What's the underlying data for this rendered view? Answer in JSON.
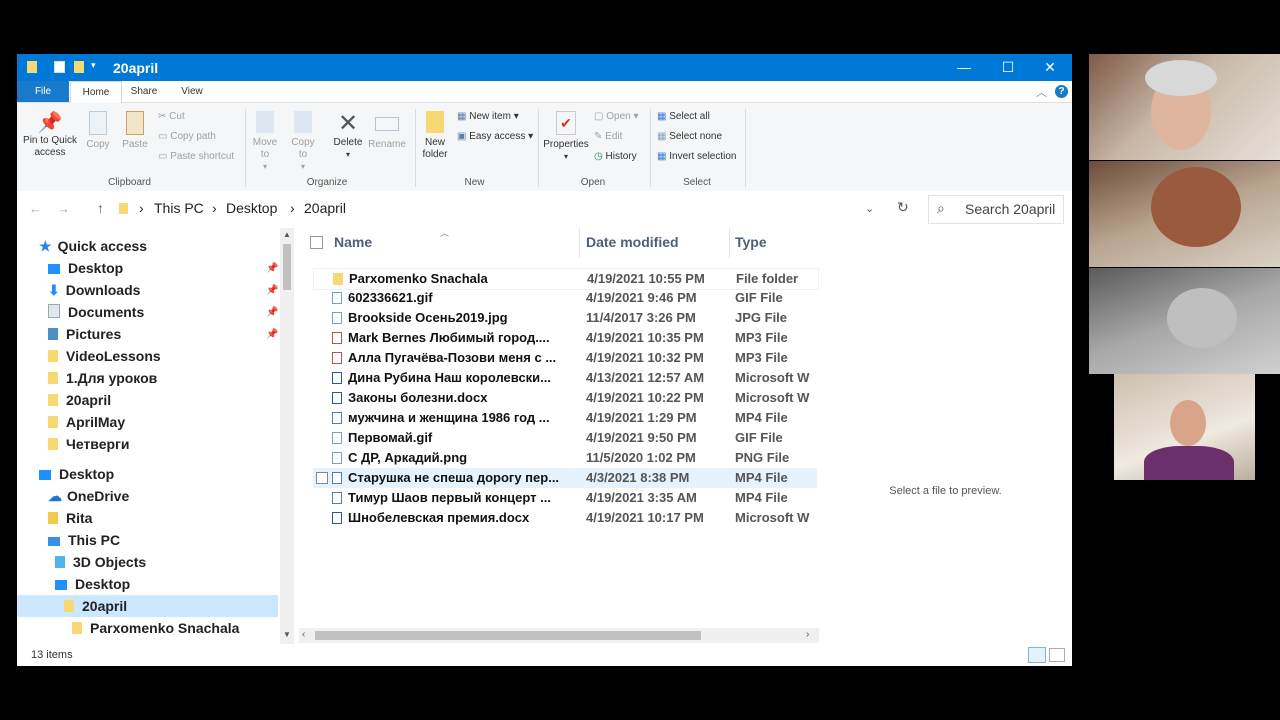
{
  "window": {
    "title": "20april",
    "min": "—",
    "max": "☐",
    "close": "✕"
  },
  "tabs": {
    "file": "File",
    "home": "Home",
    "share": "Share",
    "view": "View"
  },
  "ribbon": {
    "pin": "Pin to Quick access",
    "copy": "Copy",
    "paste": "Paste",
    "cut": "Cut",
    "copy_path": "Copy path",
    "paste_shortcut": "Paste shortcut",
    "move_to": "Move to",
    "copy_to": "Copy to",
    "delete": "Delete",
    "rename": "Rename",
    "new_folder": "New folder",
    "new_item": "New item",
    "easy_access": "Easy access",
    "properties": "Properties",
    "open": "Open",
    "edit": "Edit",
    "history": "History",
    "select_all": "Select all",
    "select_none": "Select none",
    "invert_selection": "Invert selection",
    "groups": {
      "clipboard": "Clipboard",
      "organize": "Organize",
      "new": "New",
      "open": "Open",
      "select": "Select"
    }
  },
  "address": {
    "crumbs": [
      "This PC",
      "Desktop",
      "20april"
    ],
    "search_placeholder": "Search 20april"
  },
  "sidebar": {
    "items": [
      {
        "label": "Quick access"
      },
      {
        "label": "Desktop"
      },
      {
        "label": "Downloads"
      },
      {
        "label": "Documents"
      },
      {
        "label": "Pictures"
      },
      {
        "label": "VideoLessons"
      },
      {
        "label": "1.Для уроков"
      },
      {
        "label": "20april"
      },
      {
        "label": "AprilMay"
      },
      {
        "label": "Четверги"
      },
      {
        "label": "Desktop"
      },
      {
        "label": "OneDrive"
      },
      {
        "label": "Rita"
      },
      {
        "label": "This PC"
      },
      {
        "label": "3D Objects"
      },
      {
        "label": "Desktop"
      },
      {
        "label": "20april"
      },
      {
        "label": "Parxomenko Snachala"
      }
    ]
  },
  "columns": {
    "name": "Name",
    "date": "Date modified",
    "type": "Type"
  },
  "files": [
    {
      "name": "Parxomenko Snachala",
      "date": "4/19/2021 10:55 PM",
      "type": "File folder"
    },
    {
      "name": "602336621.gif",
      "date": "4/19/2021 9:46 PM",
      "type": "GIF File"
    },
    {
      "name": "Brookside Осень2019.jpg",
      "date": "11/4/2017 3:26 PM",
      "type": "JPG File"
    },
    {
      "name": "Mark Bernes Любимый город....",
      "date": "4/19/2021 10:35 PM",
      "type": "MP3 File"
    },
    {
      "name": "Алла Пугачёва-Позови меня с ...",
      "date": "4/19/2021 10:32 PM",
      "type": "MP3 File"
    },
    {
      "name": "Дина Рубина Наш королевски...",
      "date": "4/13/2021 12:57 AM",
      "type": "Microsoft W"
    },
    {
      "name": "Законы болезни.docx",
      "date": "4/19/2021 10:22 PM",
      "type": "Microsoft W"
    },
    {
      "name": "мужчина и женщина 1986 год ...",
      "date": "4/19/2021 1:29 PM",
      "type": "MP4 File"
    },
    {
      "name": "Первомай.gif",
      "date": "4/19/2021 9:50 PM",
      "type": "GIF File"
    },
    {
      "name": "С ДР, Аркадий.png",
      "date": "11/5/2020 1:02 PM",
      "type": "PNG File"
    },
    {
      "name": "Старушка не спеша дорогу пер...",
      "date": "4/3/2021 8:38 PM",
      "type": "MP4 File"
    },
    {
      "name": "Тимур Шаов   первый концерт ...",
      "date": "4/19/2021 3:35 AM",
      "type": "MP4 File"
    },
    {
      "name": "Шнобелевская премия.docx",
      "date": "4/19/2021 10:17 PM",
      "type": "Microsoft W"
    }
  ],
  "preview": {
    "text": "Select a file to preview."
  },
  "status": {
    "count": "13 items"
  },
  "colors": {
    "accent": "#0078d7",
    "selection": "#cce8ff",
    "hover": "#e5f3ff"
  }
}
